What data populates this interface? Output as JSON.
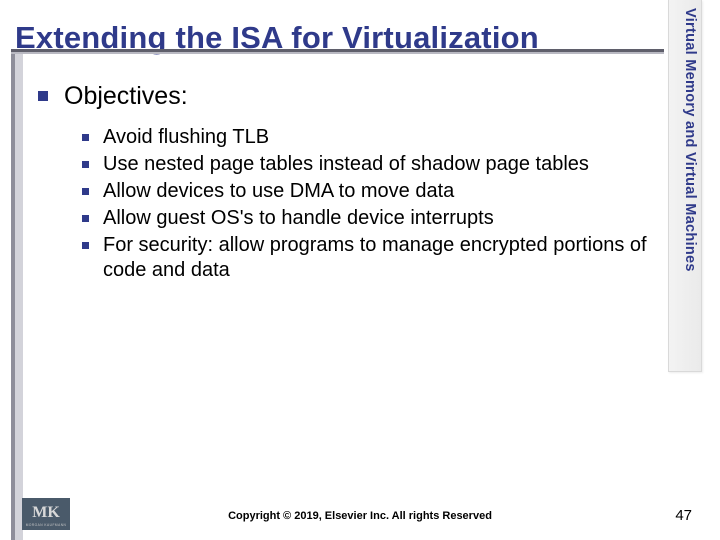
{
  "title": "Extending the ISA for Virtualization",
  "sidebar_label": "Virtual Memory and Virtual Machines",
  "lvl1_heading": "Objectives:",
  "bullets": [
    "Avoid flushing TLB",
    "Use nested page tables instead of shadow page tables",
    "Allow devices to use DMA to move data",
    "Allow guest OS's to handle device interrupts",
    "For security:  allow programs to manage encrypted portions of code and data"
  ],
  "copyright": "Copyright © 2019, Elsevier Inc. All rights Reserved",
  "page_number": "47",
  "logo_text": "MK",
  "logo_sub": "MORGAN KAUFMANN"
}
